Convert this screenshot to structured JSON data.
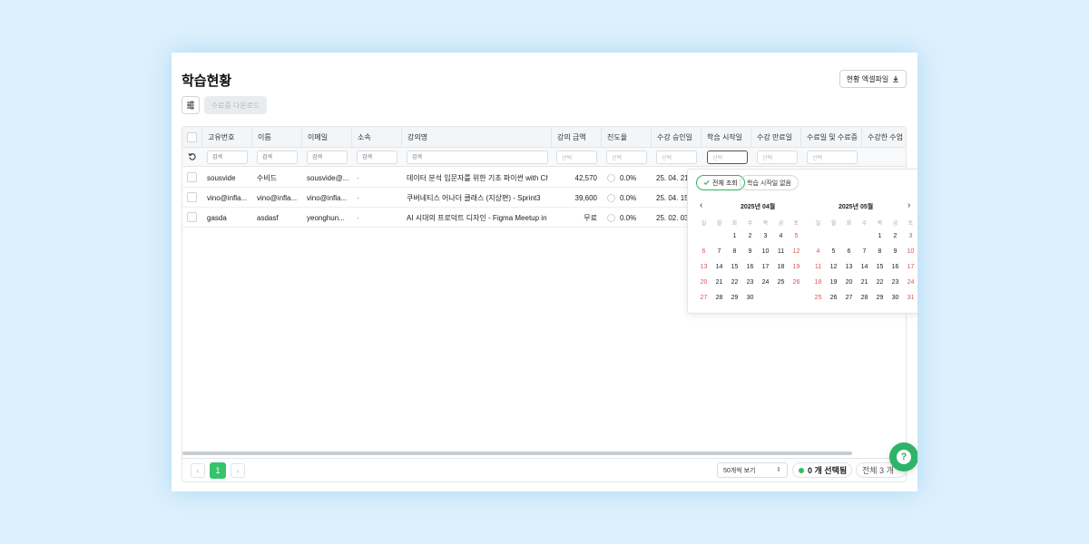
{
  "page": {
    "title": "학습현황",
    "export_label": "현황 엑셀파일",
    "cert_download_label": "수료증 다운로드"
  },
  "table": {
    "columns": [
      "고유번호",
      "이름",
      "이메일",
      "소속",
      "강의명",
      "강의 금액",
      "진도율",
      "수강 승인일",
      "학습 시작일",
      "수강 만료일",
      "수료일 및 수료증",
      "수강한 수업"
    ],
    "filters": {
      "search_placeholder": "검색",
      "select_placeholder": "선택"
    },
    "rows": [
      {
        "id": "sousvide",
        "name": "수비드",
        "email": "sousvide@...",
        "org": "-",
        "course": "데이터 분석 입문자를 위한 기초 파이썬 with Ch...",
        "price": "42,570",
        "progress": "0.0%",
        "approved": "25. 04. 21"
      },
      {
        "id": "vino@infla...",
        "name": "vino@infla...",
        "email": "vino@infla...",
        "org": "-",
        "course": "쿠버네티스 어나더 클래스 (지상편) - Sprint3",
        "price": "39,600",
        "progress": "0.0%",
        "approved": "25. 04. 15"
      },
      {
        "id": "gasda",
        "name": "asdasf",
        "email": "yeonghun...",
        "org": "-",
        "course": "AI 시대의 프로덕트 디자인 - Figma Meetup in ...",
        "price": "무료",
        "progress": "0.0%",
        "approved": "25. 02. 03"
      }
    ]
  },
  "datepicker": {
    "chip_all": "전체 조회",
    "chip_none": "학습 시작일 없음",
    "weekdays": [
      "일",
      "월",
      "화",
      "수",
      "목",
      "금",
      "토"
    ],
    "months": [
      {
        "title": "2025년 04월",
        "first_weekday": 2,
        "days": 30
      },
      {
        "title": "2025년 05월",
        "first_weekday": 4,
        "days": 31
      }
    ]
  },
  "pagination": {
    "current_page": "1",
    "per_page": "50개씩 보기",
    "selected": "0 개 선택됨",
    "total": "전체 3 개"
  },
  "colors": {
    "accent": "#35c46a",
    "help": "#2db468",
    "weekend": "#e05252"
  }
}
